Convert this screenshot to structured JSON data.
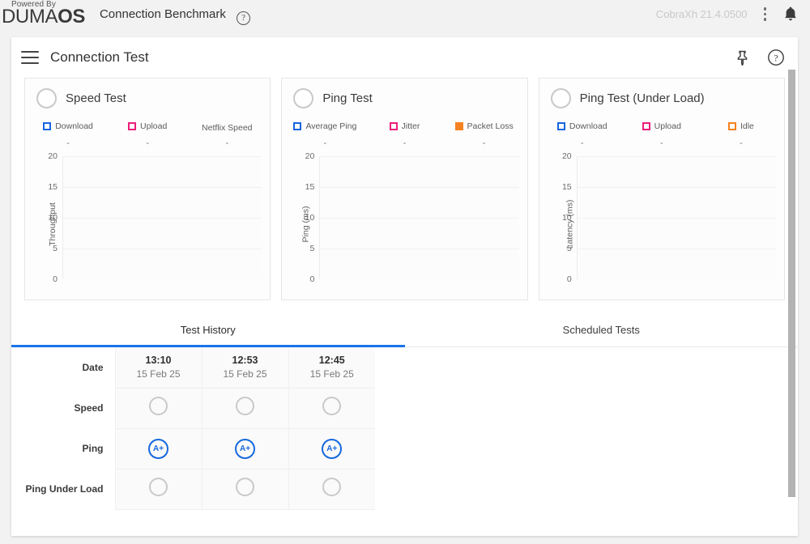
{
  "topbar": {
    "powered_by": "Powered By",
    "brand_thin": "DUMA",
    "brand_bold": "OS",
    "app_title": "Connection Benchmark",
    "help_glyph": "?",
    "version": "CobraXh 21.4.0500",
    "menu_icon": "kebab-menu-icon",
    "notification_icon": "bell-icon"
  },
  "panel": {
    "menu_icon": "hamburger-icon",
    "title": "Connection Test",
    "pin_icon": "pin-icon",
    "help_icon": "help-circle-icon"
  },
  "cards": [
    {
      "title": "Speed Test",
      "status": "idle",
      "y_axis_label": "Throughput",
      "legend": [
        {
          "label": "Download",
          "marker": "outline-blue",
          "color": "#1565e0",
          "value": "-"
        },
        {
          "label": "Upload",
          "marker": "outline-pink",
          "color": "#ed1e79",
          "value": "-"
        },
        {
          "label": "Netflix Speed",
          "marker": "none",
          "color": "",
          "value": "-"
        }
      ],
      "chart_data": {
        "type": "line",
        "title": "Speed Test",
        "ylabel": "Throughput",
        "xlabel": "",
        "yticks": [
          0,
          5,
          10,
          15,
          20
        ],
        "ylim": [
          0,
          20
        ],
        "grid": true,
        "legend_position": "top",
        "series": [
          {
            "name": "Download",
            "values": []
          },
          {
            "name": "Upload",
            "values": []
          },
          {
            "name": "Netflix Speed",
            "values": []
          }
        ],
        "x": []
      }
    },
    {
      "title": "Ping Test",
      "status": "idle",
      "y_axis_label": "Ping (ms)",
      "legend": [
        {
          "label": "Average Ping",
          "marker": "outline-blue",
          "color": "#1565e0",
          "value": "-"
        },
        {
          "label": "Jitter",
          "marker": "outline-pink",
          "color": "#ed1e79",
          "value": "-"
        },
        {
          "label": "Packet Loss",
          "marker": "filled-orange",
          "color": "#f58220",
          "value": "-"
        }
      ],
      "chart_data": {
        "type": "line",
        "title": "Ping Test",
        "ylabel": "Ping (ms)",
        "xlabel": "",
        "yticks": [
          0,
          5,
          10,
          15,
          20
        ],
        "ylim": [
          0,
          20
        ],
        "grid": true,
        "legend_position": "top",
        "series": [
          {
            "name": "Average Ping",
            "values": []
          },
          {
            "name": "Jitter",
            "values": []
          },
          {
            "name": "Packet Loss",
            "values": []
          }
        ],
        "x": []
      }
    },
    {
      "title": "Ping Test (Under Load)",
      "status": "idle",
      "y_axis_label": "Latency (ms)",
      "legend": [
        {
          "label": "Download",
          "marker": "outline-blue",
          "color": "#1565e0",
          "value": "-"
        },
        {
          "label": "Upload",
          "marker": "outline-pink",
          "color": "#ed1e79",
          "value": "-"
        },
        {
          "label": "Idle",
          "marker": "outline-orange",
          "color": "#f58220",
          "value": "-"
        }
      ],
      "chart_data": {
        "type": "line",
        "title": "Ping Test (Under Load)",
        "ylabel": "Latency (ms)",
        "xlabel": "",
        "yticks": [
          0,
          5,
          10,
          15,
          20
        ],
        "ylim": [
          0,
          20
        ],
        "grid": true,
        "legend_position": "top",
        "series": [
          {
            "name": "Download",
            "values": []
          },
          {
            "name": "Upload",
            "values": []
          },
          {
            "name": "Idle",
            "values": []
          }
        ],
        "x": []
      }
    }
  ],
  "tabs": [
    {
      "label": "Test History",
      "active": true
    },
    {
      "label": "Scheduled Tests",
      "active": false
    }
  ],
  "history": {
    "rows": [
      {
        "label": "Date",
        "type": "date"
      },
      {
        "label": "Speed",
        "type": "ring"
      },
      {
        "label": "Ping",
        "type": "grade"
      },
      {
        "label": "Ping Under Load",
        "type": "ring"
      }
    ],
    "columns": [
      {
        "time": "13:10",
        "date": "15 Feb 25",
        "speed": "",
        "ping": "A+",
        "ping_under_load": ""
      },
      {
        "time": "12:53",
        "date": "15 Feb 25",
        "speed": "",
        "ping": "A+",
        "ping_under_load": ""
      },
      {
        "time": "12:45",
        "date": "15 Feb 25",
        "speed": "",
        "ping": "A+",
        "ping_under_load": ""
      }
    ]
  },
  "colors": {
    "accent": "#1a73e8",
    "download": "#1565e0",
    "upload": "#ed1e79",
    "orange": "#f58220",
    "grade": "#1668dc"
  }
}
